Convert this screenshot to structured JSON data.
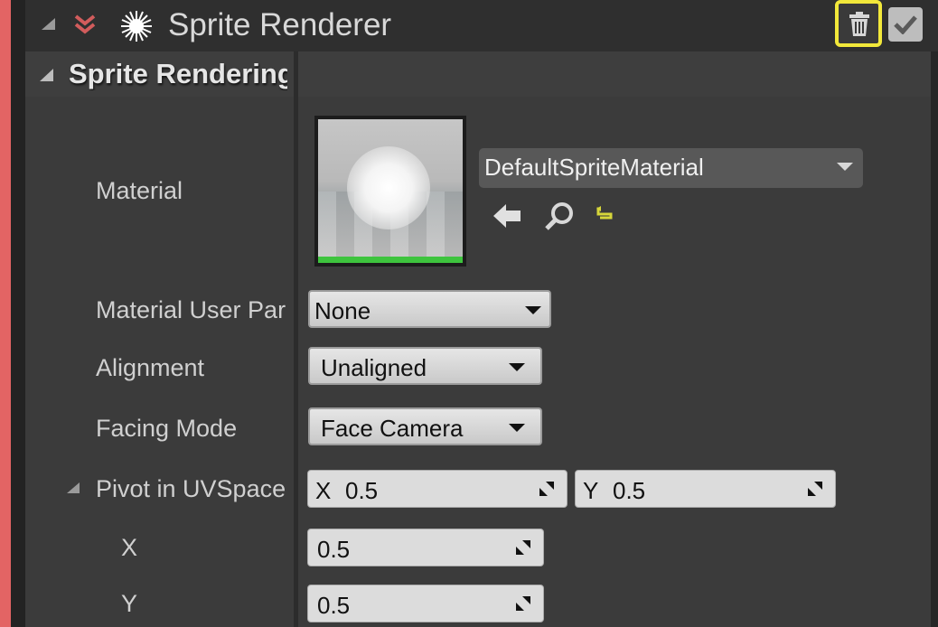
{
  "component": {
    "title": "Sprite Renderer",
    "icons": {
      "collapse": "collapse-triangle-icon",
      "mobility": "chevron-down-double-icon",
      "component": "sprite-burst-icon",
      "delete": "trash-icon",
      "enabled": "checkmark-icon"
    }
  },
  "section": {
    "title": "Sprite Rendering"
  },
  "properties": {
    "material": {
      "label": "Material",
      "value": "DefaultSpriteMaterial",
      "actions": [
        "arrow-left-icon",
        "magnifier-icon",
        "reset-icon"
      ]
    },
    "material_user_param": {
      "label": "Material User Par",
      "value": "None"
    },
    "alignment": {
      "label": "Alignment",
      "value": "Unaligned"
    },
    "facing_mode": {
      "label": "Facing Mode",
      "value": "Face Camera"
    },
    "pivot": {
      "label": "Pivot in UVSpace",
      "x_label": "X",
      "x_value": "0.5",
      "y_label": "Y",
      "y_value": "0.5"
    },
    "pivot_x": {
      "label": "X",
      "value": "0.5"
    },
    "pivot_y": {
      "label": "Y",
      "value": "0.5"
    }
  },
  "colors": {
    "accent_stripe": "#e36464",
    "highlight": "#f2e83a",
    "thumbnail_bar": "#3ec43e",
    "reset_icon": "#d6d63a"
  }
}
